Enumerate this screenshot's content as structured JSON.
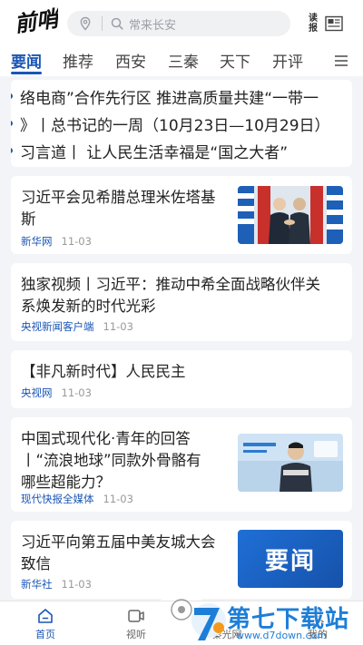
{
  "header": {
    "logo_text": "前哨",
    "search_placeholder": "常来长安",
    "read_paper_label": "读报"
  },
  "tabs": [
    {
      "label": "要闻",
      "active": true
    },
    {
      "label": "推荐",
      "active": false
    },
    {
      "label": "西安",
      "active": false
    },
    {
      "label": "三秦",
      "active": false
    },
    {
      "label": "天下",
      "active": false
    },
    {
      "label": "开评",
      "active": false
    }
  ],
  "ticker": [
    "络电商”合作先行区 推进高质量共建“一带一",
    "》丨总书记的一周（10月23日—10月29日）",
    "习言道丨 让人民生活幸福是“国之大者”"
  ],
  "news": [
    {
      "title_line1": "习近平会见希腊总理米佐塔基",
      "title_line2": "斯",
      "source": "新华网",
      "date": "11-03"
    },
    {
      "title_line1": "独家视频丨习近平：推动中希全面战略伙伴关",
      "title_line2": "系焕发新的时代光彩",
      "source": "央视新闻客户端",
      "date": "11-03"
    },
    {
      "title_line1": "【非凡新时代】人民民主",
      "title_line2": "",
      "source": "央视网",
      "date": "11-03"
    },
    {
      "title_line1": "中国式现代化·青年的回答",
      "title_line2": "丨“流浪地球”同款外骨骼有",
      "title_line3": "哪些超能力？",
      "source": "现代快报全媒体",
      "date": "11-03"
    },
    {
      "title_line1": "习近平向第五届中美友城大会",
      "title_line2": "致信",
      "source": "新华社",
      "date": "11-03",
      "thumb_text": "要闻"
    }
  ],
  "bottom_nav": [
    {
      "label": "首页",
      "active": true
    },
    {
      "label": "视听",
      "active": false
    },
    {
      "label": "",
      "active": false
    },
    {
      "label": "秦光网",
      "active": false
    },
    {
      "label": "我的",
      "active": false
    }
  ],
  "watermark": {
    "main": "第七下载站",
    "sub": "www.d7down.com"
  },
  "colors": {
    "accent": "#1a56b5",
    "watermark": "#1d7ed8"
  }
}
